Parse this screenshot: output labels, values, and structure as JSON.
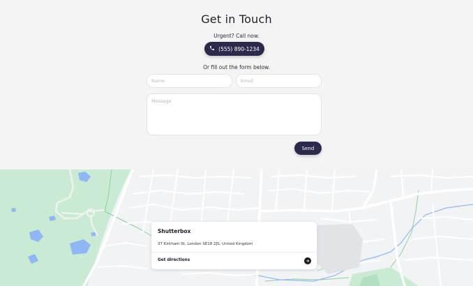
{
  "contact": {
    "title": "Get in Touch",
    "urgent_text": "Urgent? Call now.",
    "phone_label": "(555) 890-1234",
    "fill_text": "Or fill out the form below.",
    "name_placeholder": "Name",
    "email_placeholder": "Email",
    "message_placeholder": "Message",
    "send_label": "Send"
  },
  "map_card": {
    "name": "Shutterbox",
    "address": "37 Kirkham St, London SE18 2JS, United Kingdom",
    "directions_label": "Get directions"
  },
  "colors": {
    "accent": "#2b2a4c",
    "page_bg": "#f4f4f4",
    "map_bg": "#f2f3f5",
    "park": "#c9ead3",
    "water": "#8fb7f5",
    "road": "#ffffff"
  },
  "icons": {
    "phone": "phone-icon",
    "directions": "arrow-right-circle-icon"
  }
}
